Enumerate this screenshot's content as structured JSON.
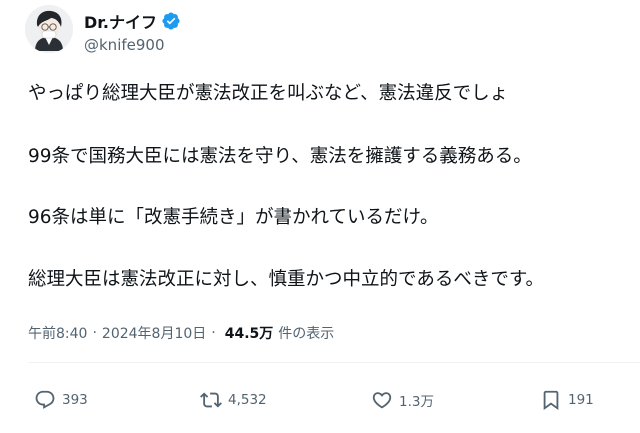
{
  "author": {
    "display_name": "Dr.ナイフ",
    "handle": "@knife900",
    "verified": true
  },
  "tweet": {
    "lines": [
      "やっぱり総理大臣が憲法改正を叫ぶなど、憲法違反でしょ",
      "99条で国務大臣には憲法を守り、憲法を擁護する義務ある。",
      "96条は単に「改憲手続き」が書かれているだけ。",
      "総理大臣は憲法改正に対し、慎重かつ中立的であるべきです。"
    ],
    "time": "午前8:40",
    "date": "2024年8月10日",
    "views_count": "44.5万",
    "views_label": "件の表示",
    "separator": "·"
  },
  "actions": {
    "replies": "393",
    "retweets": "4,532",
    "likes": "1.3万",
    "bookmarks": "191"
  },
  "colors": {
    "text": "#0f1419",
    "secondary": "#536471",
    "verified": "#1d9bf0",
    "divider": "#eff3f4"
  }
}
